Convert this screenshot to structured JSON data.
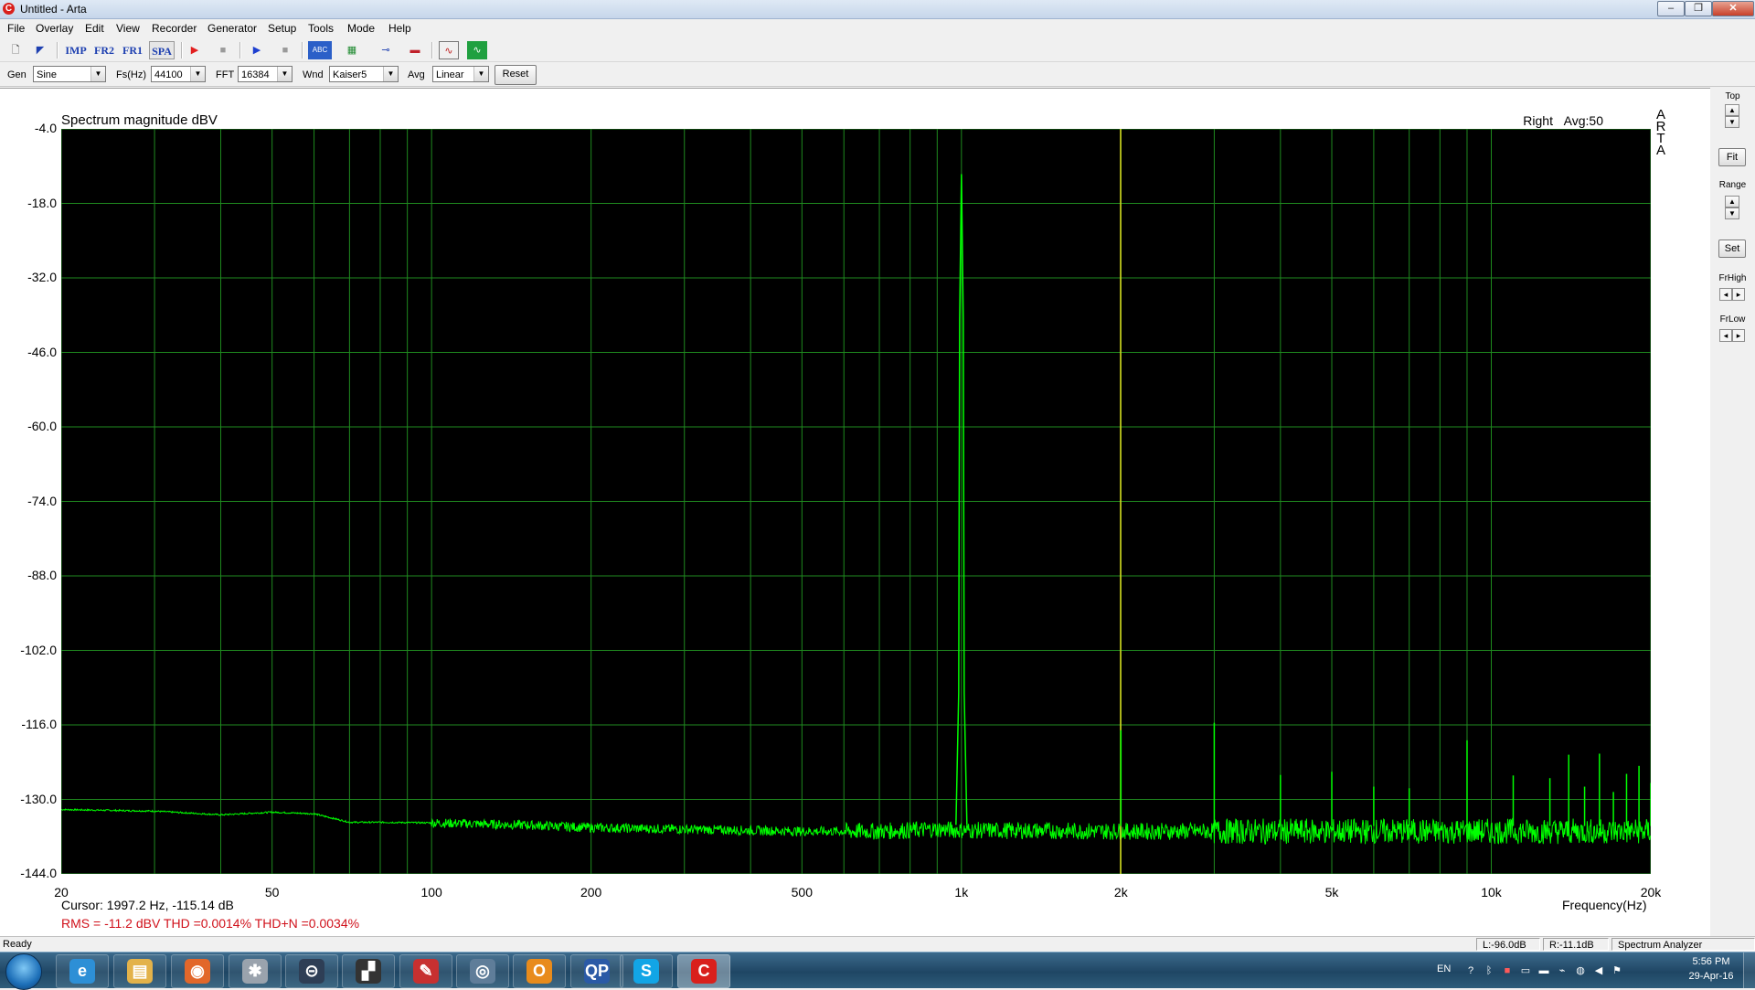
{
  "window": {
    "title": "Untitled - Arta",
    "icon_letter": "C",
    "minimize_label": "–",
    "restore_label": "❐",
    "close_label": "✕"
  },
  "menu": [
    "File",
    "Overlay",
    "Edit",
    "View",
    "Recorder",
    "Generator",
    "Setup",
    "Tools",
    "Mode",
    "Help"
  ],
  "toolbar": {
    "buttons": [
      {
        "name": "new-icon",
        "glyph": "🗋"
      },
      {
        "name": "open-icon",
        "glyph": "◤"
      },
      {
        "name": "imp-mode-button",
        "text": "IMP"
      },
      {
        "name": "fr2-mode-button",
        "text": "FR2"
      },
      {
        "name": "fr1-mode-button",
        "text": "FR1"
      },
      {
        "name": "spa-mode-button",
        "text": "SPA"
      },
      {
        "name": "record-icon",
        "glyph": "▶"
      },
      {
        "name": "stop-icon",
        "glyph": "■"
      },
      {
        "name": "play-icon",
        "glyph": "▶"
      },
      {
        "name": "stop2-icon",
        "glyph": "■"
      },
      {
        "name": "abc-icon",
        "glyph": "ABC"
      },
      {
        "name": "grid-icon",
        "glyph": "▦"
      },
      {
        "name": "cable-icon",
        "glyph": "⊸"
      },
      {
        "name": "flag-icon",
        "glyph": "▬"
      },
      {
        "name": "sine-icon",
        "glyph": "∿"
      },
      {
        "name": "scope-icon",
        "glyph": "∿"
      }
    ]
  },
  "params": {
    "gen_label": "Gen",
    "gen_value": "Sine",
    "fs_label": "Fs(Hz)",
    "fs_value": "44100",
    "fft_label": "FFT",
    "fft_value": "16384",
    "wnd_label": "Wnd",
    "wnd_value": "Kaiser5",
    "avg_label": "Avg",
    "avg_value": "Linear",
    "reset_label": "Reset"
  },
  "plot": {
    "title": "Spectrum magnitude dBV",
    "channel": "Right",
    "avg": "Avg:50",
    "brand": [
      "A",
      "R",
      "T",
      "A"
    ],
    "cursor_text": "Cursor:  1997.2 Hz, -115.14 dB",
    "stats_text": "RMS =  -11.2 dBV   THD =0.0014%   THD+N =0.0034%"
  },
  "side": {
    "top_label": "Top",
    "fit_label": "Fit",
    "range_label": "Range",
    "set_label": "Set",
    "frhigh_label": "FrHigh",
    "frlow_label": "FrLow",
    "up": "▲",
    "down": "▼",
    "left": "◂",
    "right": "▸"
  },
  "status": {
    "ready": "Ready",
    "left_level": "L:-96.0dB",
    "right_level": "R:-11.1dB",
    "mode": "Spectrum Analyzer"
  },
  "taskbar": {
    "apps": [
      {
        "name": "ie-taskbar-icon",
        "glyph": "e",
        "color": "#2d8fd6"
      },
      {
        "name": "explorer-taskbar-icon",
        "glyph": "▤",
        "color": "#e3b24a"
      },
      {
        "name": "firefox-taskbar-icon",
        "glyph": "◉",
        "color": "#e2672a"
      },
      {
        "name": "tool-taskbar-icon",
        "glyph": "✱",
        "color": "#9aa3ad"
      },
      {
        "name": "lock-taskbar-icon",
        "glyph": "⊝",
        "color": "#2e3e55"
      },
      {
        "name": "clapper-taskbar-icon",
        "glyph": "▞",
        "color": "#333333"
      },
      {
        "name": "pdf-taskbar-icon",
        "glyph": "✎",
        "color": "#c73030"
      },
      {
        "name": "webcam-taskbar-icon",
        "glyph": "◎",
        "color": "#5f7d99"
      },
      {
        "name": "outlook-taskbar-icon",
        "glyph": "O",
        "color": "#e88b1c"
      },
      {
        "name": "qp-taskbar-icon",
        "glyph": "QP",
        "color": "#2b5aa6"
      },
      {
        "name": "skype-taskbar-icon",
        "glyph": "S",
        "color": "#12a5e6"
      },
      {
        "name": "arta-taskbar-icon",
        "glyph": "C",
        "color": "#d9201c"
      }
    ],
    "lang": "EN",
    "time": "5:56 PM",
    "date": "29-Apr-16"
  },
  "chart_data": {
    "type": "line",
    "title": "Spectrum magnitude dBV",
    "xlabel": "Frequency(Hz)",
    "ylabel": "",
    "x_scale": "log",
    "xlim": [
      20,
      20000
    ],
    "ylim": [
      -144,
      -4
    ],
    "x_ticks": [
      20,
      50,
      100,
      200,
      500,
      1000,
      2000,
      5000,
      10000,
      20000
    ],
    "x_tick_labels": [
      "20",
      "50",
      "100",
      "200",
      "500",
      "1k",
      "2k",
      "5k",
      "10k",
      "20k"
    ],
    "y_ticks": [
      -4,
      -18,
      -32,
      -46,
      -60,
      -74,
      -88,
      -102,
      -116,
      -130,
      -144
    ],
    "y_tick_labels": [
      "-4.0",
      "-18.0",
      "-32.0",
      "-46.0",
      "-60.0",
      "-74.0",
      "-88.0",
      "-102.0",
      "-116.0",
      "-130.0",
      "-144.0"
    ],
    "grid": true,
    "line_color": "#00ff00",
    "grid_color": "#1f8a1f",
    "cursor_x": 1997.2,
    "cursor_color": "#e0e020",
    "noise_floor": [
      [
        20,
        -131.9
      ],
      [
        30,
        -132.2
      ],
      [
        40,
        -132.9
      ],
      [
        50,
        -132.4
      ],
      [
        60,
        -132.7
      ],
      [
        70,
        -134.3
      ],
      [
        80,
        -134.3
      ],
      [
        100,
        -134.4
      ],
      [
        150,
        -134.8
      ],
      [
        200,
        -135.3
      ],
      [
        300,
        -135.6
      ],
      [
        500,
        -136.0
      ],
      [
        700,
        -136.0
      ],
      [
        900,
        -135.6
      ],
      [
        1000,
        -135.8
      ],
      [
        1500,
        -135.9
      ],
      [
        2000,
        -136.0
      ],
      [
        3000,
        -136.0
      ],
      [
        5000,
        -136.0
      ],
      [
        10000,
        -136.0
      ],
      [
        20000,
        -136.0
      ]
    ],
    "peaks": [
      {
        "freq": 1000,
        "db": -12.5
      },
      {
        "freq": 2000,
        "db": -117.0
      },
      {
        "freq": 3000,
        "db": -115.6
      },
      {
        "freq": 4000,
        "db": -125.4
      },
      {
        "freq": 5000,
        "db": -124.8
      },
      {
        "freq": 6000,
        "db": -127.6
      },
      {
        "freq": 7000,
        "db": -127.9
      },
      {
        "freq": 9000,
        "db": -118.9
      },
      {
        "freq": 11000,
        "db": -125.5
      },
      {
        "freq": 12900,
        "db": -126.0
      },
      {
        "freq": 14000,
        "db": -121.6
      },
      {
        "freq": 15000,
        "db": -127.6
      },
      {
        "freq": 16000,
        "db": -121.4
      },
      {
        "freq": 17000,
        "db": -128.6
      },
      {
        "freq": 18000,
        "db": -125.2
      },
      {
        "freq": 19000,
        "db": -123.7
      },
      {
        "freq": 20000,
        "db": -126.9
      }
    ]
  }
}
